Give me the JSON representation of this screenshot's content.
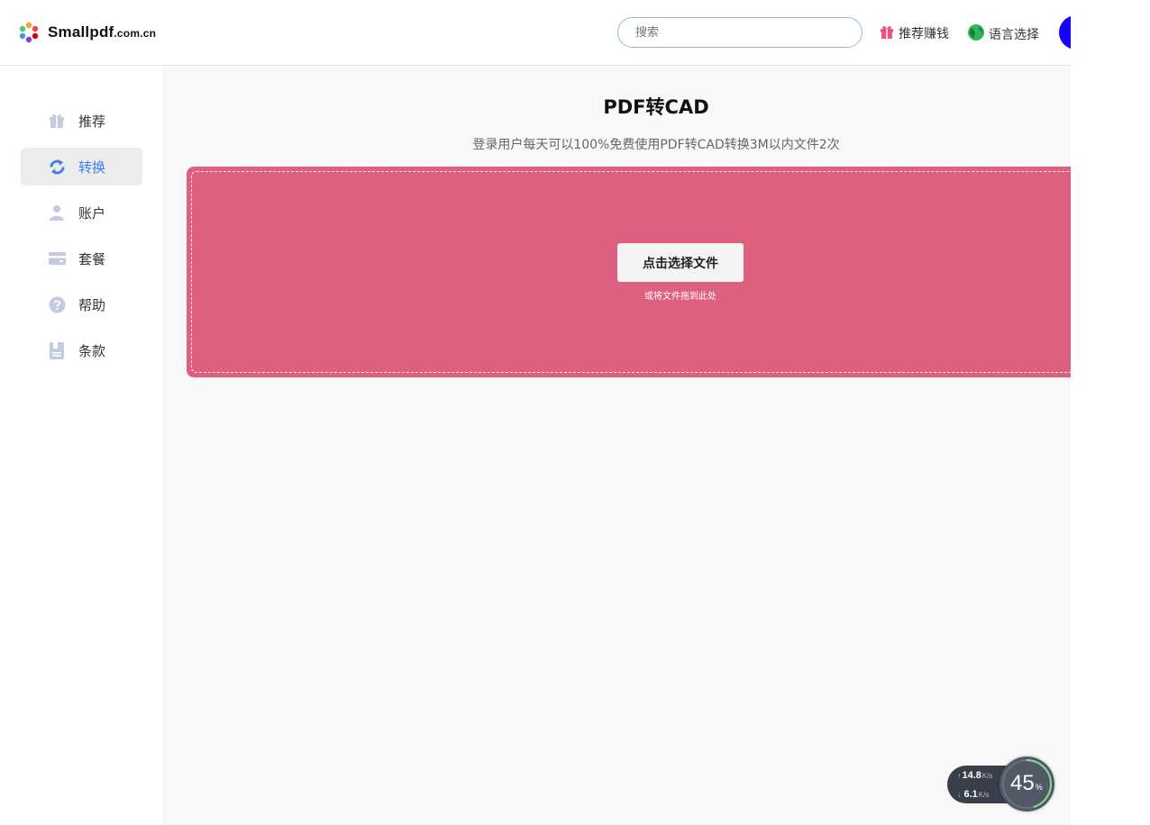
{
  "header": {
    "logo_main": "Smallpdf",
    "logo_suffix": ".com.cn",
    "search_placeholder": "搜索",
    "refer_label": "推荐赚钱",
    "lang_label": "语言选择"
  },
  "sidebar": {
    "items": [
      {
        "label": "推荐",
        "icon": "gift-icon"
      },
      {
        "label": "转换",
        "icon": "convert-icon",
        "active": true
      },
      {
        "label": "账户",
        "icon": "user-icon"
      },
      {
        "label": "套餐",
        "icon": "card-icon"
      },
      {
        "label": "帮助",
        "icon": "help-icon"
      },
      {
        "label": "条款",
        "icon": "document-icon"
      }
    ]
  },
  "main": {
    "title": "PDF转CAD",
    "subtitle": "登录用户每天可以100%免费使用PDF转CAD转换3M以内文件2次",
    "choose_button": "点击选择文件",
    "drop_hint": "或将文件拖到此处"
  },
  "netwidget": {
    "upload": "14.8",
    "upload_unit": "K/s",
    "download": "6.1",
    "download_unit": "K/s",
    "usage": "45",
    "usage_unit": "%",
    "usage_fraction": 0.45
  },
  "colors": {
    "accent": "#3d7df0",
    "dropzone": "#de6080",
    "avatar": "#1400ff"
  }
}
